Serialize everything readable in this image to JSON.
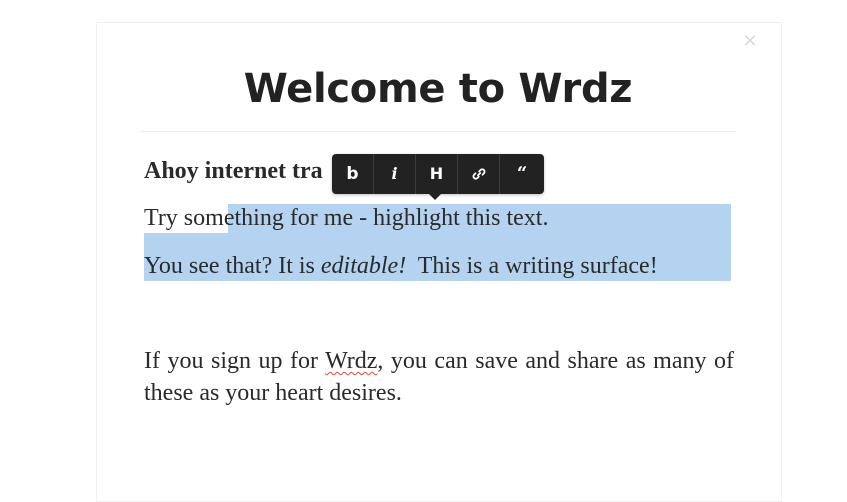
{
  "modal": {
    "close_symbol": "×",
    "title": "Welcome to Wrdz"
  },
  "content": {
    "greeting": "Ahoy internet tra",
    "line1_unselected": "Try som",
    "line1_selected": "ething for me - highlight this text.",
    "line2_before": "You see that? It is ",
    "line2_italic": "editable!",
    "line2_after": "  This is a writing surface!",
    "para3_before": "If you sign up for ",
    "para3_misspelled": "Wrdz",
    "para3_after": ", you can save and share as many of these as your heart desires."
  },
  "toolbar": {
    "bold": "b",
    "italic": "i",
    "heading": "H",
    "quote": "“",
    "buttons": [
      "bold-icon",
      "italic-icon",
      "heading-icon",
      "link-icon",
      "quote-icon"
    ]
  },
  "colors": {
    "selection": "#b4d3f0",
    "toolbar_bg": "#222222",
    "text": "#2a2a2a",
    "spellcheck": "#e04a3a"
  }
}
